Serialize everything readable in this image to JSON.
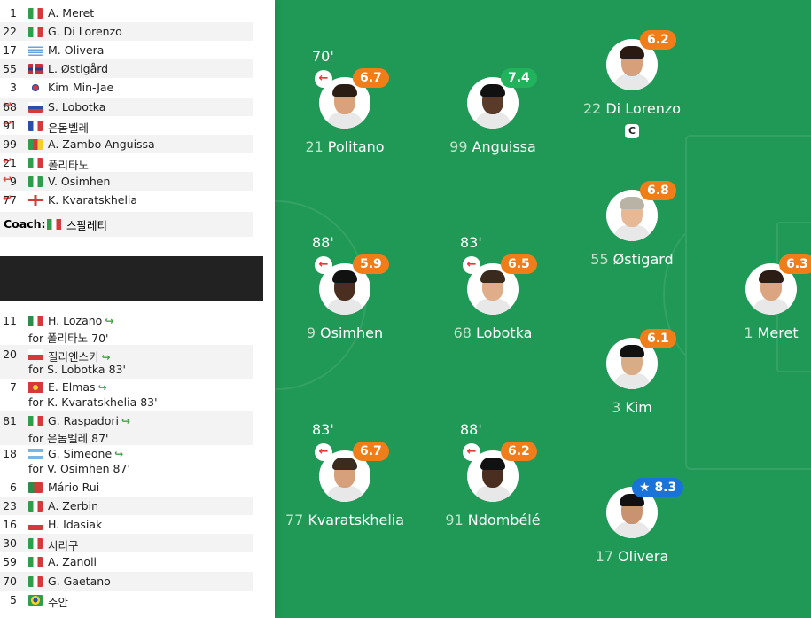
{
  "starting": [
    {
      "num": "1",
      "name": "A. Meret",
      "flag": "italy",
      "subbed": false
    },
    {
      "num": "22",
      "name": "G. Di Lorenzo",
      "flag": "italy",
      "subbed": false
    },
    {
      "num": "17",
      "name": "M. Olivera",
      "flag": "uruguay",
      "subbed": false
    },
    {
      "num": "55",
      "name": "L. Østigård",
      "flag": "norway",
      "subbed": false
    },
    {
      "num": "3",
      "name": "Kim Min-Jae",
      "flag": "south-korea",
      "subbed": false
    },
    {
      "num": "68",
      "name": "S. Lobotka",
      "flag": "slovakia",
      "subbed": true
    },
    {
      "num": "91",
      "name": "은돔벨레",
      "flag": "france",
      "subbed": true
    },
    {
      "num": "99",
      "name": "A. Zambo Anguissa",
      "flag": "cameroon",
      "subbed": false
    },
    {
      "num": "21",
      "name": "폴리타노",
      "flag": "italy",
      "subbed": true
    },
    {
      "num": "9",
      "name": "V. Osimhen",
      "flag": "nigeria",
      "subbed": true
    },
    {
      "num": "77",
      "name": "K. Kvaratskhelia",
      "flag": "georgia",
      "subbed": true
    }
  ],
  "coach": {
    "label": "Coach:",
    "name": "스팔레티",
    "flag": "italy"
  },
  "substitutes": [
    {
      "num": "11",
      "name": "H. Lozano",
      "flag": "mexico",
      "for": "for 폴리타노 70'"
    },
    {
      "num": "20",
      "name": "질리엔스키",
      "flag": "poland",
      "for": "for S. Lobotka 83'"
    },
    {
      "num": "7",
      "name": "E. Elmas",
      "flag": "north-macedonia",
      "for": "for K. Kvaratskhelia 83'"
    },
    {
      "num": "81",
      "name": "G. Raspadori",
      "flag": "italy",
      "for": "for 은돔벨레 87'"
    },
    {
      "num": "18",
      "name": "G. Simeone",
      "flag": "argentina",
      "for": "for V. Osimhen 87'"
    }
  ],
  "bench": [
    {
      "num": "6",
      "name": "Mário Rui",
      "flag": "portugal"
    },
    {
      "num": "23",
      "name": "A. Zerbin",
      "flag": "italy"
    },
    {
      "num": "16",
      "name": "H. Idasiak",
      "flag": "poland"
    },
    {
      "num": "30",
      "name": "시리구",
      "flag": "italy"
    },
    {
      "num": "59",
      "name": "A. Zanoli",
      "flag": "italy"
    },
    {
      "num": "70",
      "name": "G. Gaetano",
      "flag": "italy"
    },
    {
      "num": "5",
      "name": "주안",
      "flag": "brazil"
    }
  ],
  "pitch_players": [
    {
      "num": "21",
      "name": "Politano",
      "rating": "6.7",
      "rating_color": "orange",
      "sub_minute": "70'",
      "skin": "#d9a27c",
      "hair": "#2b1d14"
    },
    {
      "num": "99",
      "name": "Anguissa",
      "rating": "7.4",
      "rating_color": "green",
      "sub_minute": "",
      "skin": "#5a3a28",
      "hair": "#111111"
    },
    {
      "num": "22",
      "name": "Di Lorenzo",
      "rating": "6.2",
      "rating_color": "orange",
      "sub_minute": "",
      "captain": "C",
      "skin": "#d7a07b",
      "hair": "#2a1a12"
    },
    {
      "num": "55",
      "name": "Østigard",
      "rating": "6.8",
      "rating_color": "orange",
      "sub_minute": "",
      "skin": "#e6b896",
      "hair": "#b9b3a6"
    },
    {
      "num": "9",
      "name": "Osimhen",
      "rating": "5.9",
      "rating_color": "orange",
      "sub_minute": "88'",
      "skin": "#4a2e20",
      "hair": "#111111"
    },
    {
      "num": "68",
      "name": "Lobotka",
      "rating": "6.5",
      "rating_color": "orange",
      "sub_minute": "83'",
      "skin": "#e0ad8a",
      "hair": "#3a2a1e"
    },
    {
      "num": "1",
      "name": "Meret",
      "rating": "6.3",
      "rating_color": "orange",
      "sub_minute": "",
      "skin": "#dca582",
      "hair": "#2b1d14"
    },
    {
      "num": "3",
      "name": "Kim",
      "rating": "6.1",
      "rating_color": "orange",
      "sub_minute": "",
      "skin": "#d9ac88",
      "hair": "#111111"
    },
    {
      "num": "77",
      "name": "Kvaratskhelia",
      "rating": "6.7",
      "rating_color": "orange",
      "sub_minute": "83'",
      "skin": "#d6a07d",
      "hair": "#3b2a20"
    },
    {
      "num": "91",
      "name": "Ndombélé",
      "rating": "6.2",
      "rating_color": "orange",
      "sub_minute": "88'",
      "skin": "#4a2e20",
      "hair": "#111111"
    },
    {
      "num": "17",
      "name": "Olivera",
      "rating": "8.3",
      "rating_color": "blue",
      "star": "★",
      "sub_minute": "",
      "skin": "#c99271",
      "hair": "#111111"
    }
  ],
  "colors": {
    "pitch": "#1f9955",
    "rating_orange": "#ef7d1a",
    "rating_green": "#21b35b",
    "rating_blue": "#1a73d9"
  }
}
